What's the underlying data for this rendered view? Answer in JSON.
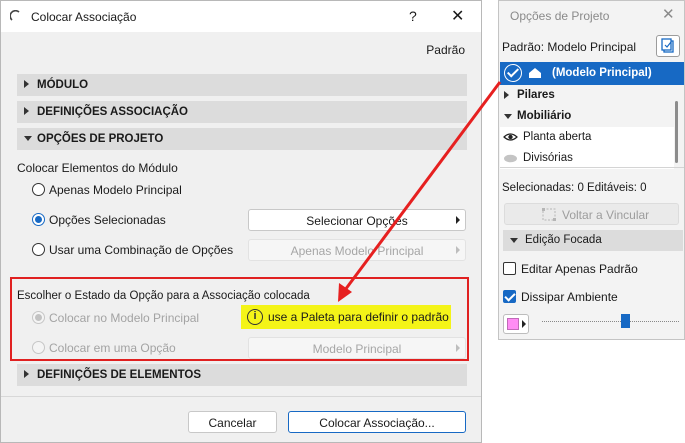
{
  "dialog": {
    "title": "Colocar Associação",
    "help": "?",
    "close": "✕",
    "default_label": "Padrão",
    "sections": {
      "module": "MÓDULO",
      "association": "DEFINIÇÕES ASSOCIAÇÃO",
      "project_options": "OPÇÕES DE PROJETO",
      "elements": "DEFINIÇÕES DE ELEMENTOS"
    },
    "place_module_elements": "Colocar Elementos do Módulo",
    "radios": {
      "main_only": "Apenas Modelo Principal",
      "selected_options": "Opções Selecionadas",
      "combination": "Usar uma Combinação de Opções"
    },
    "buttons": {
      "select_options": "Selecionar Opções",
      "main_model_only": "Apenas Modelo Principal"
    },
    "state_heading": "Escolher o Estado da Opção para a Associação colocada",
    "state_radios": {
      "in_main_model": "Colocar no Modelo Principal",
      "in_option": "Colocar em uma Opção"
    },
    "tip": "use a Paleta para definir o padrão",
    "main_model_dropdown": "Modelo Principal",
    "cancel": "Cancelar",
    "place": "Colocar Associação..."
  },
  "palette": {
    "title": "Opções de Projeto",
    "close": "✕",
    "standard": "Padrão: Modelo Principal",
    "selected_item": "(Modelo Principal)",
    "tree": [
      "Pilares",
      "Mobiliário",
      "Planta aberta",
      "Divisórias"
    ],
    "counts": "Selecionadas: 0 Editáveis: 0",
    "link_button": "Voltar a Vincular",
    "focused_edit": "Edição Focada",
    "edit_standard_only": "Editar Apenas Padrão",
    "dim_environment": "Dissipar Ambiente"
  },
  "colors": {
    "accent": "#1769c4",
    "highlight_red": "#e02020",
    "tip_yellow": "#f4f418",
    "swatch": "#ff8cf4"
  }
}
